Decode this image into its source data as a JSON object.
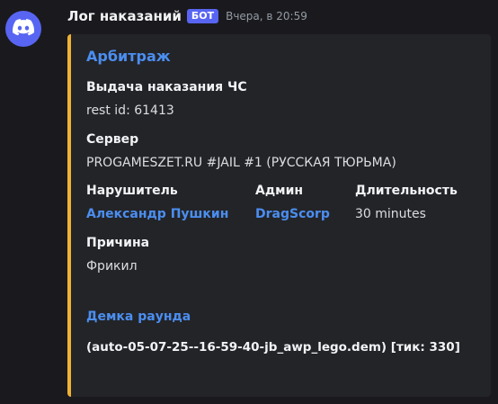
{
  "message": {
    "author": "Лог наказаний",
    "bot_tag": "БОТ",
    "timestamp": "Вчера, в 20:59",
    "avatar_icon": "discord-logo-icon"
  },
  "embed": {
    "accent_color": "#f0b232",
    "title": "Арбитраж",
    "fields": {
      "punishment": {
        "name": "Выдача наказания ЧС",
        "value": "rest id: 61413"
      },
      "server": {
        "name": "Сервер",
        "value": "PROGAMESZET.RU #JAIL #1 (РУССКАЯ ТЮРЬМА)"
      },
      "offender": {
        "name": "Нарушитель",
        "value": "Александр Пушкин"
      },
      "admin": {
        "name": "Админ",
        "value": "DragScorp"
      },
      "duration": {
        "name": "Длительность",
        "value": "30 minutes"
      },
      "reason": {
        "name": "Причина",
        "value": "Фрикил"
      }
    },
    "demo": {
      "title": "Демка раунда",
      "text": "(auto-05-07-25--16-59-40-jb_awp_lego.dem) [тик: 330]"
    }
  },
  "colors": {
    "background": "#1a1a1e",
    "embed_background": "#232428",
    "link": "#4b8ef0",
    "blurple": "#5865f2"
  }
}
